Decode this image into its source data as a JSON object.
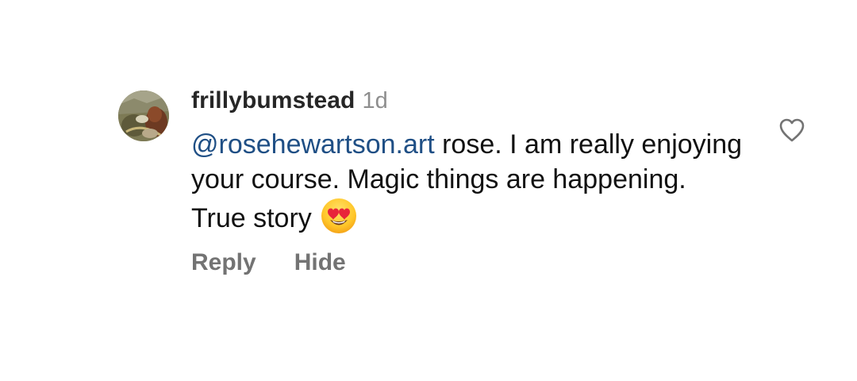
{
  "comment": {
    "username": "frillybumstead",
    "timestamp": "1d",
    "mention": "@rosehewartson.art",
    "text": " rose. I am really enjoying your course. Magic things are happening. True story",
    "emoji": "smiling-face-with-heart-eyes"
  },
  "actions": {
    "reply_label": "Reply",
    "hide_label": "Hide"
  },
  "icons": {
    "like": "heart-outline-icon"
  },
  "colors": {
    "mention": "#1f4f85",
    "username": "#262626",
    "secondary": "#8e8e8e",
    "action": "#737373"
  }
}
